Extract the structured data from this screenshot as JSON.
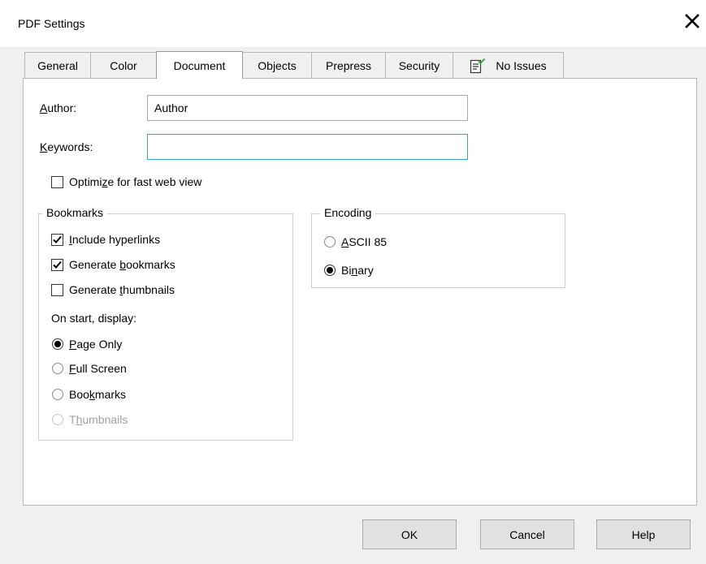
{
  "window": {
    "title": "PDF Settings",
    "close_icon": "close-icon"
  },
  "tabs": [
    {
      "label": "General"
    },
    {
      "label": "Color"
    },
    {
      "label": "Document",
      "active": true
    },
    {
      "label": "Objects"
    },
    {
      "label": "Prepress"
    },
    {
      "label": "Security"
    },
    {
      "label": "No Issues",
      "icon": "checklist-ok-icon"
    }
  ],
  "document": {
    "author": {
      "label_key": "A",
      "label_rest": "uthor:",
      "value": "Author"
    },
    "keywords": {
      "label_key": "K",
      "label_rest": "eywords:",
      "value": ""
    },
    "optimize": {
      "pre": "Optimi",
      "key": "z",
      "post": "e for fast web view",
      "checked": false
    }
  },
  "bookmarks": {
    "legend": "Bookmarks",
    "include_hyperlinks": {
      "pre": "",
      "key": "I",
      "post": "nclude hyperlinks",
      "checked": true
    },
    "generate_bookmarks": {
      "pre": "Generate ",
      "key": "b",
      "post": "ookmarks",
      "checked": true
    },
    "generate_thumbnails": {
      "pre": "Generate ",
      "key": "t",
      "post": "humbnails",
      "checked": false
    },
    "on_start_label": "On start, display:",
    "options": [
      {
        "pre": "",
        "key": "P",
        "post": "age Only",
        "selected": true,
        "enabled": true
      },
      {
        "pre": "",
        "key": "F",
        "post": "ull Screen",
        "selected": false,
        "enabled": true
      },
      {
        "pre": "Boo",
        "key": "k",
        "post": "marks",
        "selected": false,
        "enabled": true
      },
      {
        "pre": "T",
        "key": "h",
        "post": "umbnails",
        "selected": false,
        "enabled": false
      }
    ]
  },
  "encoding": {
    "legend": "Encoding",
    "options": [
      {
        "pre": "",
        "key": "A",
        "post": "SCII 85",
        "selected": false
      },
      {
        "pre": "Bi",
        "key": "n",
        "post": "ary",
        "selected": true
      }
    ]
  },
  "buttons": {
    "ok": "OK",
    "cancel": "Cancel",
    "help": "Help"
  },
  "colors": {
    "focus_border": "#3c9ed6",
    "check_green": "#2ea043"
  }
}
